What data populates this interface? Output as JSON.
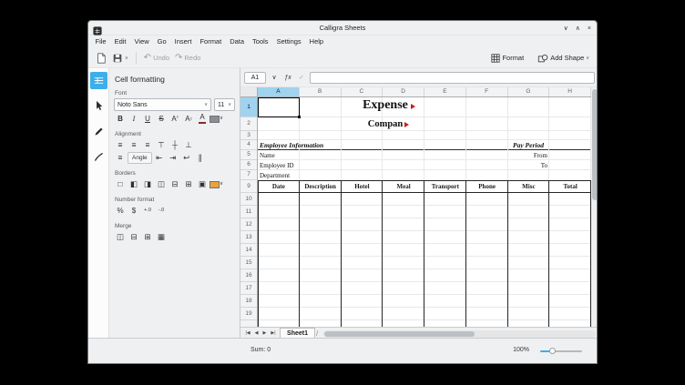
{
  "colors": {
    "accent": "#3daee9",
    "selected_header_bg": "#9fd3ef",
    "border_color_swatch": "#e8a33d",
    "overflow_marker": "#c81e1e",
    "window_bg": "#eff0f1"
  },
  "window": {
    "title": "Calligra Sheets"
  },
  "window_controls": {
    "minimize": "∨",
    "maximize": "∧",
    "close": "×"
  },
  "menubar": [
    "File",
    "Edit",
    "View",
    "Go",
    "Insert",
    "Format",
    "Data",
    "Tools",
    "Settings",
    "Help"
  ],
  "toolbar": {
    "undo": "Undo",
    "redo": "Redo",
    "format": "Format",
    "add_shape": "Add Shape"
  },
  "formula_bar": {
    "cell_ref": "A1",
    "function": "ƒx",
    "input_value": ""
  },
  "panel": {
    "title": "Cell formatting",
    "font_label": "Font",
    "font_family": "Noto Sans",
    "font_size": "11",
    "bold": "B",
    "italic": "I",
    "underline": "U",
    "strike": "S",
    "letter": "A",
    "sup_mark": "²",
    "sub_mark": "₂",
    "alignment_label": "Alignment",
    "angle": "Angle",
    "borders_label": "Borders",
    "number_label": "Number format",
    "percent": "%",
    "money": "$",
    "prec_plus": "+.0",
    "prec_minus": "-.0",
    "merge_label": "Merge"
  },
  "glyphs": {
    "caret": "∨",
    "check": "✓",
    "undo": "↶",
    "redo": "↷",
    "align_left": "≡",
    "align_center": "≡",
    "align_right": "≡",
    "valign_top": "⊤",
    "valign_mid": "┼",
    "valign_bottom": "⊥",
    "justify": "≡",
    "indent_less": "⇤",
    "indent_more": "⇥",
    "wrap": "↩",
    "vertical_text": "∥",
    "border_none": "□",
    "border_left": "◧",
    "border_right": "◨",
    "border_vertical": "◫",
    "border_horizontal": "⊟",
    "border_all": "⊞",
    "border_outline": "▣",
    "merge_cells": "◫",
    "merge_horizontal": "⊟",
    "merge_vertical": "⊞",
    "dissolve": "▦",
    "nav_first": "|◀",
    "nav_prev": "◀",
    "nav_next": "▶",
    "nav_last": "▶|",
    "tab_slash": "/"
  },
  "sheet": {
    "columns": [
      "A",
      "B",
      "C",
      "D",
      "E",
      "F",
      "G",
      "H"
    ],
    "rows": [
      "1",
      "2",
      "3",
      "4",
      "5",
      "6",
      "7",
      "9",
      "10",
      "11",
      "12",
      "13",
      "14",
      "15",
      "16",
      "17",
      "18",
      "19"
    ],
    "selected_cell": "A1",
    "cells": {
      "title": "Expense",
      "company": "Compan",
      "employee_information": "Employee Information",
      "pay_period": "Pay Period",
      "name": "Name",
      "from": "From",
      "employee_id": "Employee ID",
      "to": "To",
      "department": "Department"
    },
    "table_headers": [
      "Date",
      "Description",
      "Hotel",
      "Meal",
      "Transport",
      "Phone",
      "Misc",
      "Total"
    ],
    "tab": "Sheet1"
  },
  "status": {
    "sum": "Sum: 0",
    "zoom": "100%"
  }
}
